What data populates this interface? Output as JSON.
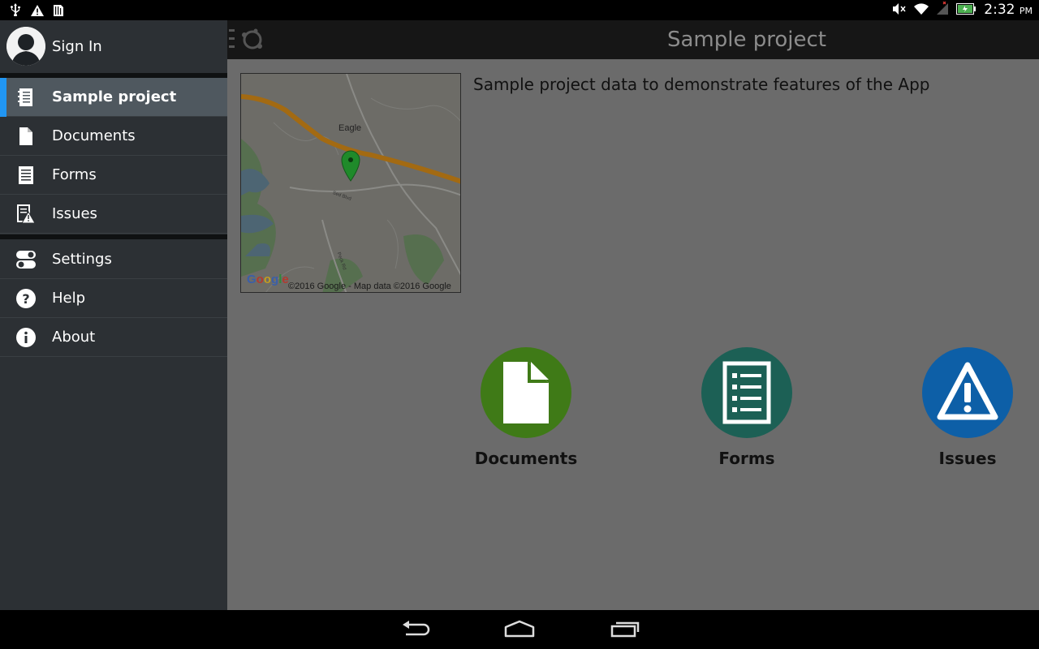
{
  "status_bar": {
    "time": "2:32",
    "ampm": "PM",
    "left_icons": [
      "usb-icon",
      "warning-icon",
      "sim-icon"
    ],
    "right_icons": [
      "mute-icon",
      "wifi-icon",
      "no-signal-icon",
      "battery-charging-icon"
    ]
  },
  "app_bar": {
    "title": "Sample project"
  },
  "drawer": {
    "signin_label": "Sign In",
    "project_items": [
      {
        "label": "Sample project",
        "icon": "notebook-icon",
        "active": true
      },
      {
        "label": "Documents",
        "icon": "document-icon",
        "active": false
      },
      {
        "label": "Forms",
        "icon": "form-icon",
        "active": false
      },
      {
        "label": "Issues",
        "icon": "issues-icon",
        "active": false
      }
    ],
    "app_items": [
      {
        "label": "Settings",
        "icon": "toggle-icon"
      },
      {
        "label": "Help",
        "icon": "help-icon"
      },
      {
        "label": "About",
        "icon": "info-icon"
      }
    ]
  },
  "project": {
    "description": "Sample project data to demonstrate features of the App",
    "map": {
      "place_label": "Eagle",
      "street_labels": [
        "Sed Blvd",
        "Peck Rd"
      ],
      "logo_text": "Google",
      "copyright": "©2016 Google - Map data ©2016 Google"
    },
    "shortcuts": [
      {
        "label": "Documents",
        "icon": "document-icon",
        "color": "#3f7a17"
      },
      {
        "label": "Forms",
        "icon": "form-icon",
        "color": "#1c6055"
      },
      {
        "label": "Issues",
        "icon": "warning-icon",
        "color": "#0d5fa7"
      }
    ]
  },
  "colors": {
    "accent": "#2196f3",
    "drawer_bg": "#2c3034",
    "active_item_bg": "#4f585f",
    "main_bg": "#6b6b6b"
  }
}
